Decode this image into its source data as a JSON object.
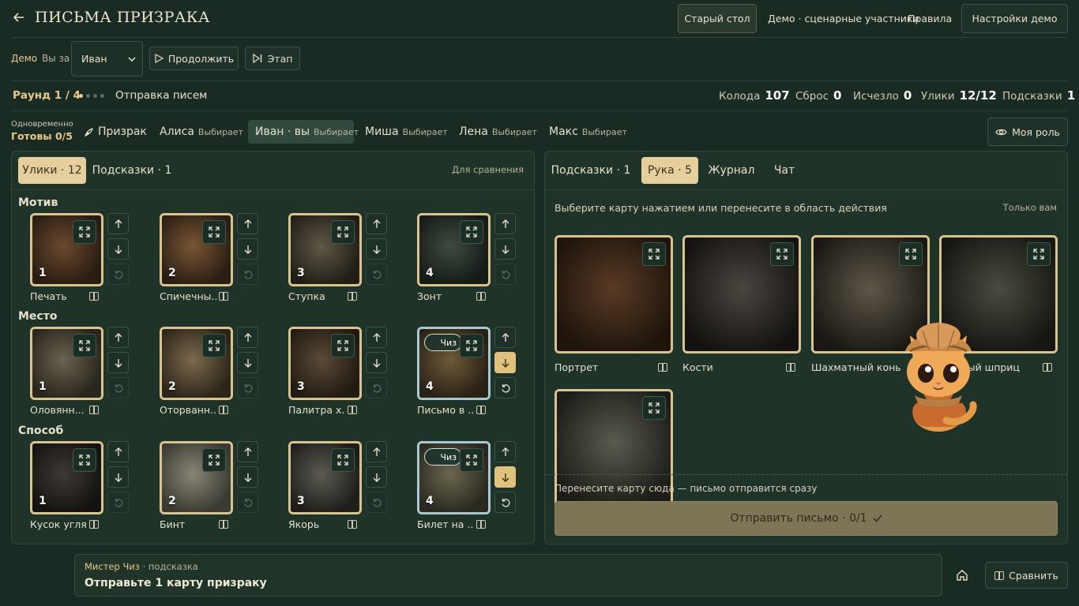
{
  "header": {
    "back_icon": "arrow-left-icon",
    "title": "ПИСЬМА ПРИЗРАКА",
    "old_table": "Старый стол",
    "demo_participants": "Демо · сценарные участники",
    "rules": "Правила",
    "demo_settings": "Настройки демо"
  },
  "demo_bar": {
    "demo_label": "Демо",
    "you_for_label": "Вы за",
    "player_select_value": "Иван",
    "continue_label": "Продолжить",
    "step_label": "Этап"
  },
  "round": {
    "round_label": "Раунд 1 / 4",
    "phase": "Отправка писем",
    "stats": [
      {
        "label": "Колода",
        "value": "107"
      },
      {
        "label": "Сброс",
        "value": "0"
      },
      {
        "label": "Исчезло",
        "value": "0"
      },
      {
        "label": "Улики",
        "value": "12/12"
      },
      {
        "label": "Подсказки",
        "value": "1"
      }
    ]
  },
  "players_bar": {
    "simultaneous_label": "Одновременно",
    "ready_label": "Готовы 0/5",
    "players": [
      {
        "name": "Призрак",
        "status": ""
      },
      {
        "name": "Алиса",
        "status": "Выбирает"
      },
      {
        "name": "Иван · вы",
        "status": "Выбирает"
      },
      {
        "name": "Миша",
        "status": "Выбирает"
      },
      {
        "name": "Лена",
        "status": "Выбирает"
      },
      {
        "name": "Макс",
        "status": "Выбирает"
      }
    ],
    "my_role_label": "Моя роль"
  },
  "left_panel": {
    "tabs": [
      "Улики · 12",
      "Подсказки · 1"
    ],
    "compare_note": "Для сравнения",
    "sections": [
      {
        "title": "Мотив",
        "cards": [
          {
            "num": "1",
            "label": "Печать",
            "chip": ""
          },
          {
            "num": "2",
            "label": "Спичечны...",
            "chip": ""
          },
          {
            "num": "3",
            "label": "Ступка",
            "chip": ""
          },
          {
            "num": "4",
            "label": "Зонт",
            "chip": ""
          }
        ]
      },
      {
        "title": "Место",
        "cards": [
          {
            "num": "1",
            "label": "Оловянн...",
            "chip": ""
          },
          {
            "num": "2",
            "label": "Оторванн...",
            "chip": ""
          },
          {
            "num": "3",
            "label": "Палитра х...",
            "chip": ""
          },
          {
            "num": "4",
            "label": "Письмо в ...",
            "chip": "Чиз"
          }
        ]
      },
      {
        "title": "Способ",
        "cards": [
          {
            "num": "1",
            "label": "Кусок угля",
            "chip": ""
          },
          {
            "num": "2",
            "label": "Бинт",
            "chip": ""
          },
          {
            "num": "3",
            "label": "Якорь",
            "chip": ""
          },
          {
            "num": "4",
            "label": "Билет на ...",
            "chip": "Чиз"
          }
        ]
      }
    ]
  },
  "right_panel": {
    "tabs": [
      "Подсказки · 1",
      "Рука · 5",
      "Журнал",
      "Чат"
    ],
    "instruction": "Выберите карту нажатием или перенесите в область действия",
    "only_you": "Только вам",
    "hand_cards": [
      "Портрет",
      "Кости",
      "Шахматный конь",
      "...янный шприц",
      ""
    ],
    "drop_hint": "Перенесите карту сюда — письмо отправится сразу",
    "send_button": "Отправить письмо · 0/1"
  },
  "footer": {
    "hint_author": "Мистер Чиз",
    "hint_type": " · подсказка",
    "hint_text": "Отправьте 1 карту призраку",
    "home_icon": "home-icon",
    "compare_label": "Сравнить"
  },
  "colors": {
    "background": "#1a2b23",
    "accent_gold": "#e5cf9c",
    "card_border": "#d9c38e",
    "selected_border": "#a9c9d0",
    "send_button": "#7d7555"
  }
}
